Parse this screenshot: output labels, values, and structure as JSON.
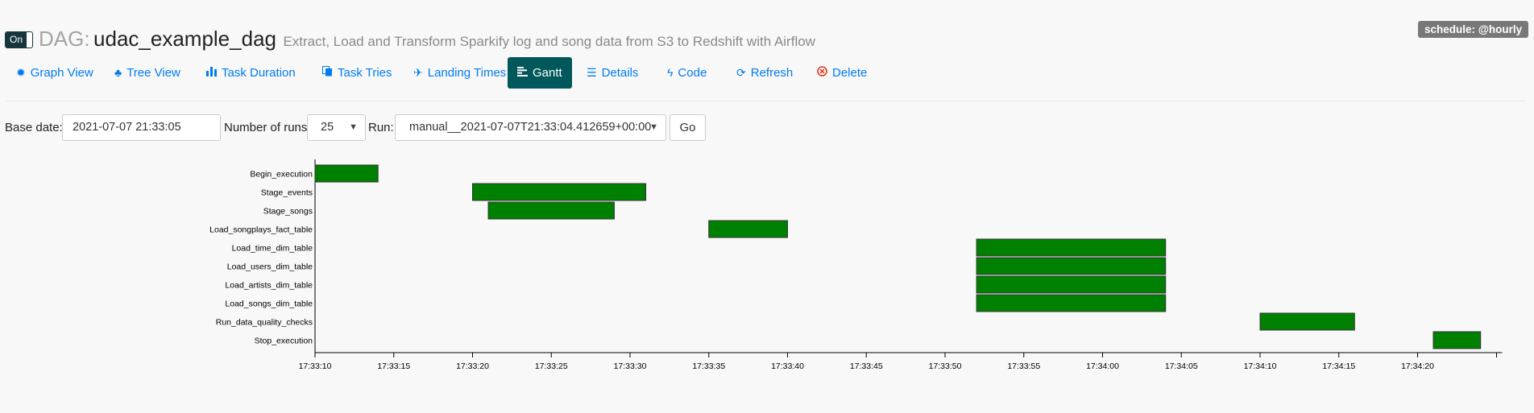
{
  "dag": {
    "toggle_label": "On",
    "prefix": "DAG:",
    "dag_id": "udac_example_dag",
    "description": "Extract, Load and Transform Sparkify log and song data from S3 to Redshift with Airflow",
    "schedule": "schedule: @hourly"
  },
  "nav": {
    "tabs": [
      {
        "label": "Graph View",
        "icon": "graph-icon",
        "active": false
      },
      {
        "label": "Tree View",
        "icon": "tree-icon",
        "active": false
      },
      {
        "label": "Task Duration",
        "icon": "bar-chart-icon",
        "active": false
      },
      {
        "label": "Task Tries",
        "icon": "duplicate-icon",
        "active": false
      },
      {
        "label": "Landing Times",
        "icon": "plane-icon",
        "active": false
      },
      {
        "label": "Gantt",
        "icon": "gantt-icon",
        "active": true
      },
      {
        "label": "Details",
        "icon": "list-icon",
        "active": false
      },
      {
        "label": "Code",
        "icon": "flash-icon",
        "active": false
      },
      {
        "label": "Refresh",
        "icon": "refresh-icon",
        "active": false
      },
      {
        "label": "Delete",
        "icon": "delete-icon",
        "active": false
      }
    ]
  },
  "form": {
    "base_date_label": "Base date:",
    "base_date_value": "2021-07-07 21:33:05",
    "num_runs_label": "Number of runs:",
    "num_runs_value": "25",
    "run_label": "Run:",
    "run_value": "manual__2021-07-07T21:33:04.412659+00:00",
    "go_label": "Go"
  },
  "colors": {
    "accent": "#017cee",
    "active_tab": "#00585a",
    "bar_fill": "#008000",
    "delete": "#e43921"
  },
  "chart_data": {
    "type": "gantt",
    "x_ticks": [
      "17:33:10",
      "17:33:15",
      "17:33:20",
      "17:33:25",
      "17:33:30",
      "17:33:35",
      "17:33:40",
      "17:33:45",
      "17:33:50",
      "17:33:55",
      "17:34:00",
      "17:34:05",
      "17:34:10",
      "17:34:15",
      "17:34:20"
    ],
    "tasks": [
      {
        "name": "Begin_execution",
        "start": "17:33:10",
        "end": "17:33:14"
      },
      {
        "name": "Stage_events",
        "start": "17:33:20",
        "end": "17:33:31"
      },
      {
        "name": "Stage_songs",
        "start": "17:33:21",
        "end": "17:33:29"
      },
      {
        "name": "Load_songplays_fact_table",
        "start": "17:33:35",
        "end": "17:33:40"
      },
      {
        "name": "Load_time_dim_table",
        "start": "17:33:52",
        "end": "17:34:04"
      },
      {
        "name": "Load_users_dim_table",
        "start": "17:33:52",
        "end": "17:34:04"
      },
      {
        "name": "Load_artists_dim_table",
        "start": "17:33:52",
        "end": "17:34:04"
      },
      {
        "name": "Load_songs_dim_table",
        "start": "17:33:52",
        "end": "17:34:04"
      },
      {
        "name": "Run_data_quality_checks",
        "start": "17:34:10",
        "end": "17:34:16"
      },
      {
        "name": "Stop_execution",
        "start": "17:34:21",
        "end": "17:34:24"
      }
    ]
  }
}
